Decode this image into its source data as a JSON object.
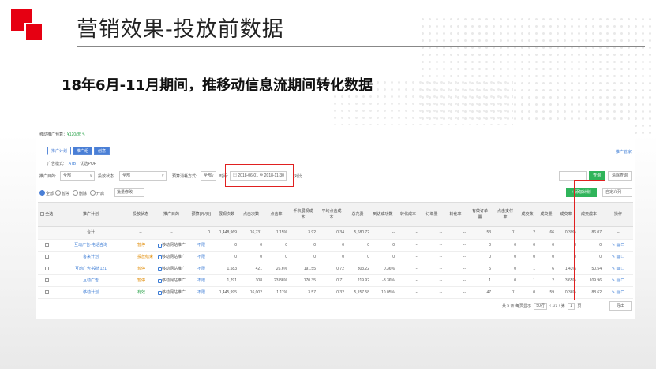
{
  "slide": {
    "title": "营销效果-投放前数据",
    "subtitle": "18年6月-11月期间，推移动信息流期间转化数据"
  },
  "app": {
    "budget_label": "移动推广预算：",
    "budget_value": "¥120/天",
    "tabs": [
      "推广计划",
      "推广组",
      "创意"
    ],
    "help_link": "推广管家",
    "mode_label": "广告模式:",
    "mode_selected": "ATB",
    "mode_other": "优选POP",
    "filters": {
      "target_label": "推广目的:",
      "target_value": "全部",
      "status_label": "投放状态:",
      "status_value": "全部",
      "spend_label": "预算消耗方式:",
      "spend_value": "全部",
      "time_label": "时间:",
      "date_range": "2018-06-01 至 2018-11-30",
      "compare_label": "对比",
      "query_button": "查询",
      "clear_button": "清除查询"
    },
    "actions": {
      "all": "全部",
      "pause": "暂停",
      "delete": "删除",
      "enable": "开启",
      "batch_label": "批量修改",
      "add_plan": "+ 添加计划",
      "column_setting": "自定义列"
    },
    "columns": [
      "全选",
      "推广计划",
      "投放状态",
      "推广目的",
      "预算(元/天)",
      "展现次数",
      "点击次数",
      "点击率",
      "千次展现成本",
      "平均点击成本",
      "总花费",
      "到访成功数",
      "转化成本",
      "订单量",
      "转化率",
      "有效支付订单量",
      "点击支付率",
      "成交数",
      "成交量",
      "成交率",
      "成交成本",
      "操作"
    ],
    "columns_short": {
      "c8": [
        "千次展现成",
        "本"
      ],
      "c9": [
        "平均点击成",
        "本"
      ],
      "c14": [
        "有效订单",
        "量"
      ],
      "c15": [
        "点击支付",
        "率"
      ]
    },
    "totals": {
      "label": "合计",
      "budget": "0",
      "impressions": "1,448,969",
      "clicks": "16,731",
      "ctr": "1.15%",
      "cpm": "3.92",
      "cpc": "0.34",
      "cost": "5,680.72",
      "visits": "--",
      "conv_cost": "--",
      "orders": "--",
      "conv_rate": "--",
      "valid_orders": "53",
      "pay_rate": "11",
      "deals": "2",
      "deal_qty": "66",
      "deal_rate": "0.39%",
      "deal_cost": "86.07",
      "op": "--"
    },
    "rows": [
      {
        "name": "互动广告-电话咨询",
        "status": "暂停",
        "status_class": "st-ok",
        "target": "移动网站推广",
        "budget": "不限",
        "impressions": "0",
        "clicks": "0",
        "ctr": "0",
        "cpm": "0",
        "cpc": "0",
        "cost": "0",
        "visits": "0",
        "conv_cost": "--",
        "orders": "--",
        "conv_rate": "--",
        "valid_orders": "0",
        "pay_rate": "0",
        "deals": "0",
        "deal_qty": "0",
        "deal_rate": "0",
        "deal_cost": "0"
      },
      {
        "name": "客来计划",
        "status": "投放结束",
        "status_class": "st-warn",
        "target": "移动网站推广",
        "budget": "不限",
        "impressions": "0",
        "clicks": "0",
        "ctr": "0",
        "cpm": "0",
        "cpc": "0",
        "cost": "0",
        "visits": "0",
        "conv_cost": "--",
        "orders": "--",
        "conv_rate": "--",
        "valid_orders": "0",
        "pay_rate": "0",
        "deals": "0",
        "deal_qty": "0",
        "deal_rate": "0",
        "deal_cost": "0"
      },
      {
        "name": "互动广告-投放121",
        "status": "暂停",
        "status_class": "st-ok",
        "target": "移动网站推广",
        "budget": "不限",
        "impressions": "1,583",
        "clicks": "421",
        "ctr": "26.6%",
        "cpm": "191.55",
        "cpc": "0.72",
        "cost": "303.22",
        "visits": "0.36%",
        "conv_cost": "--",
        "orders": "--",
        "conv_rate": "--",
        "valid_orders": "5",
        "pay_rate": "0",
        "deals": "1",
        "deal_qty": "6",
        "deal_rate": "1.43%",
        "deal_cost": "50.54"
      },
      {
        "name": "互动广告",
        "status": "暂停",
        "status_class": "st-ok",
        "target": "移动网站推广",
        "budget": "不限",
        "impressions": "1,291",
        "clicks": "308",
        "ctr": "23.86%",
        "cpm": "170.35",
        "cpc": "0.71",
        "cost": "219.92",
        "visits": "-3.36%",
        "conv_cost": "--",
        "orders": "--",
        "conv_rate": "--",
        "valid_orders": "1",
        "pay_rate": "0",
        "deals": "1",
        "deal_qty": "2",
        "deal_rate": "3.65%",
        "deal_cost": "109.96"
      },
      {
        "name": "移动计划",
        "status": "有效",
        "status_class": "st-ok2",
        "target": "移动网站推广",
        "budget": "不限",
        "impressions": "1,445,995",
        "clicks": "16,002",
        "ctr": "1.11%",
        "cpm": "3.57",
        "cpc": "0.32",
        "cost": "5,157.58",
        "visits": "10.05%",
        "conv_cost": "--",
        "orders": "--",
        "conv_rate": "--",
        "valid_orders": "47",
        "pay_rate": "11",
        "deals": "0",
        "deal_qty": "59",
        "deal_rate": "0.36%",
        "deal_cost": "88.62"
      }
    ],
    "pager": {
      "total": "共 5 条",
      "per_page_label": "每页显示",
      "per_page": "50行",
      "page": "1/1",
      "goto": "第",
      "goto_page": "1",
      "goto_unit": "页",
      "export": "导出"
    }
  }
}
